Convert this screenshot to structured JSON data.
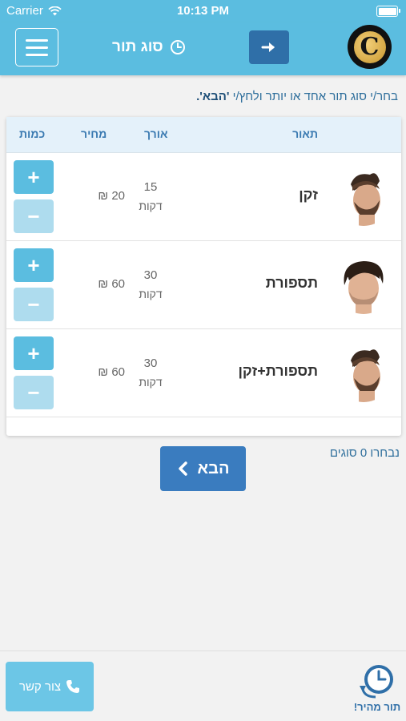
{
  "status_bar": {
    "carrier": "Carrier",
    "time": "10:13 PM",
    "icons": [
      "wifi-icon",
      "battery-icon"
    ]
  },
  "nav": {
    "title": "סוג תור",
    "title_icon": "clock-icon",
    "menu_icon": "hamburger-icon",
    "back_icon": "arrow-right-icon",
    "logo_letter": "C"
  },
  "instruction": {
    "prefix": "בחר/י סוג תור אחד או יותר ולחץ/י ",
    "highlight": "'הבא'."
  },
  "table": {
    "headers": {
      "description": "תאור",
      "duration": "אורך",
      "price": "מחיר",
      "quantity": "כמות"
    },
    "rows": [
      {
        "name": "זקן",
        "duration": "15",
        "duration_unit": "דקות",
        "price": "20 ₪",
        "plus": "+",
        "minus": "−"
      },
      {
        "name": "תספורת",
        "duration": "30",
        "duration_unit": "דקות",
        "price": "60 ₪",
        "plus": "+",
        "minus": "−"
      },
      {
        "name": "תספורת+זקן",
        "duration": "30",
        "duration_unit": "דקות",
        "price": "60 ₪",
        "plus": "+",
        "minus": "−"
      }
    ]
  },
  "selection": {
    "count_text": "נבחרו 0 סוגים"
  },
  "next_button": {
    "label": "הבא",
    "icon": "chevron-left-icon"
  },
  "footer": {
    "contact_label": "צור קשר",
    "contact_icon": "phone-icon",
    "quick_label": "תור מהיר!",
    "quick_icon": "clock-arrow-icon"
  },
  "colors": {
    "header_bg": "#5bbde0",
    "accent_dark": "#2f6fa8",
    "plus_bg": "#5bbde0",
    "minus_bg": "#aedcee",
    "next_bg": "#3a7cbf"
  }
}
